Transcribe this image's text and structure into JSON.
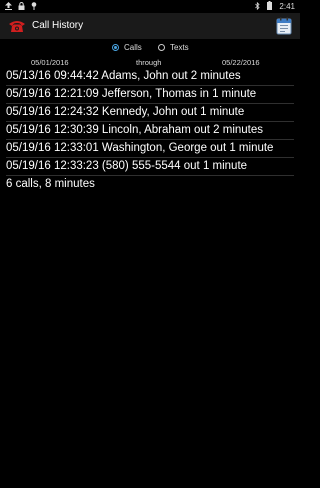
{
  "status_bar": {
    "time": "2:41",
    "left_icons": [
      "upload-icon",
      "lock-icon",
      "pin-icon"
    ],
    "right_icons": [
      "bluetooth-icon",
      "battery-icon"
    ]
  },
  "app_bar": {
    "title": "Call History",
    "app_icon": "red-telephone-icon",
    "action_icon": "calendar-icon"
  },
  "filter": {
    "options": [
      "Calls",
      "Texts"
    ],
    "selected": "Calls"
  },
  "date_range": {
    "from": "05/01/2016",
    "through_label": "through",
    "to": "05/22/2016"
  },
  "calls": [
    "05/13/16 09:44:42 Adams, John out 2 minutes",
    "05/19/16 12:21:09 Jefferson, Thomas in 1 minute",
    "05/19/16 12:24:32 Kennedy, John out 1 minute",
    "05/19/16 12:30:39 Lincoln, Abraham out 2 minutes",
    "05/19/16 12:33:01 Washington, George out 1 minute",
    "05/19/16 12:33:23 (580) 555-5544 out 1 minute"
  ],
  "summary": "6 calls, 8 minutes",
  "colors": {
    "background": "#000000",
    "app_bar": "#1a1a1a",
    "accent": "#4aa3df",
    "phone_red": "#d11f1f"
  }
}
